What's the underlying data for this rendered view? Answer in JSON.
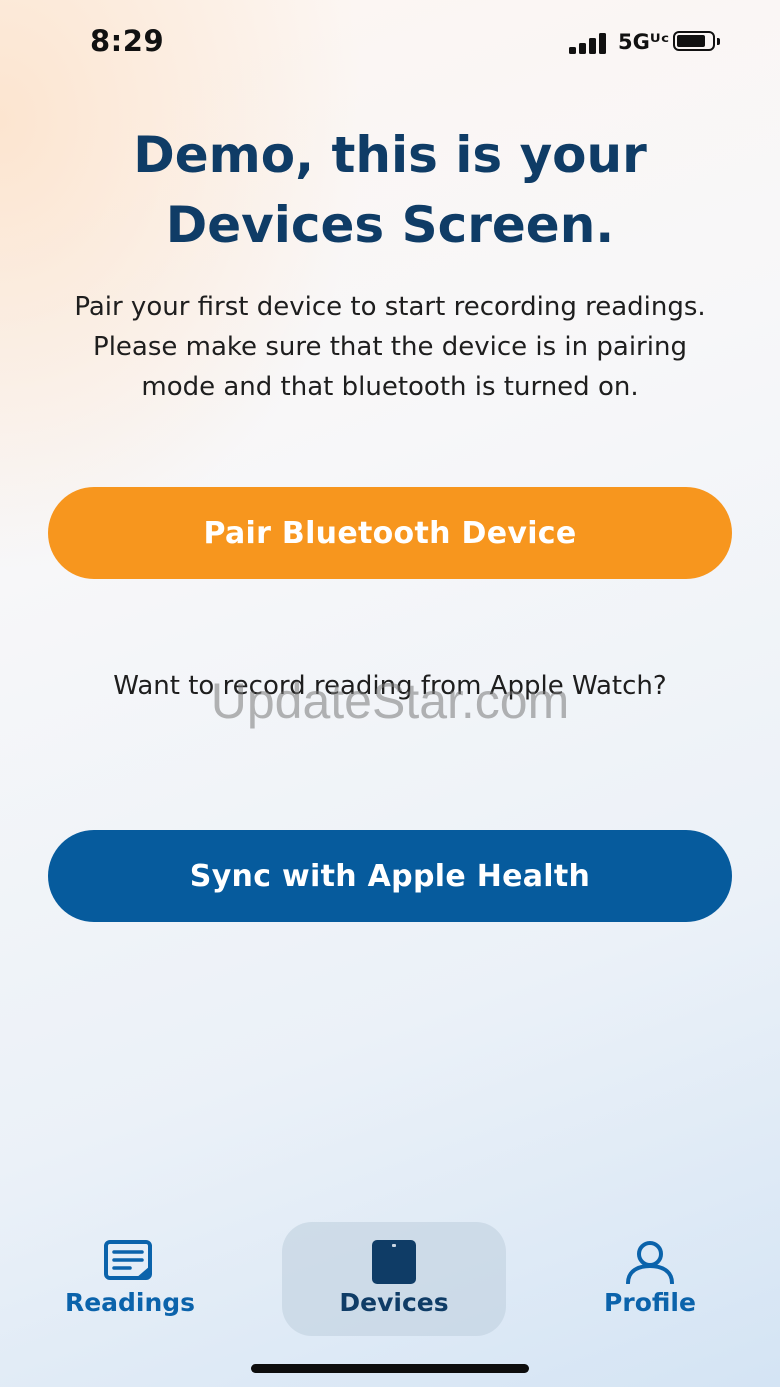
{
  "status_bar": {
    "time": "8:29",
    "network": "5Gᵁᶜ"
  },
  "main": {
    "headline": "Demo, this is your Devices Screen.",
    "intro": "Pair your first device to start recording readings. Please make sure that the device is in pairing mode and that bluetooth is turned on.",
    "pair_button_label": "Pair Bluetooth Device",
    "apple_prompt": "Want to record reading from Apple Watch?",
    "health_button_label": "Sync with Apple Health"
  },
  "watermark": "UpdateStar.com",
  "tab_bar": {
    "tabs": [
      {
        "label": "Readings",
        "icon": "readings-icon",
        "selected": false
      },
      {
        "label": "Devices",
        "icon": "device-icon",
        "selected": true
      },
      {
        "label": "Profile",
        "icon": "profile-icon",
        "selected": false
      }
    ]
  },
  "colors": {
    "headline": "#0f3c66",
    "pair_button": "#f7961e",
    "health_button": "#065b9d",
    "tab_active_bg": "#c9d6e3",
    "tab_label": "#0b63ab"
  }
}
